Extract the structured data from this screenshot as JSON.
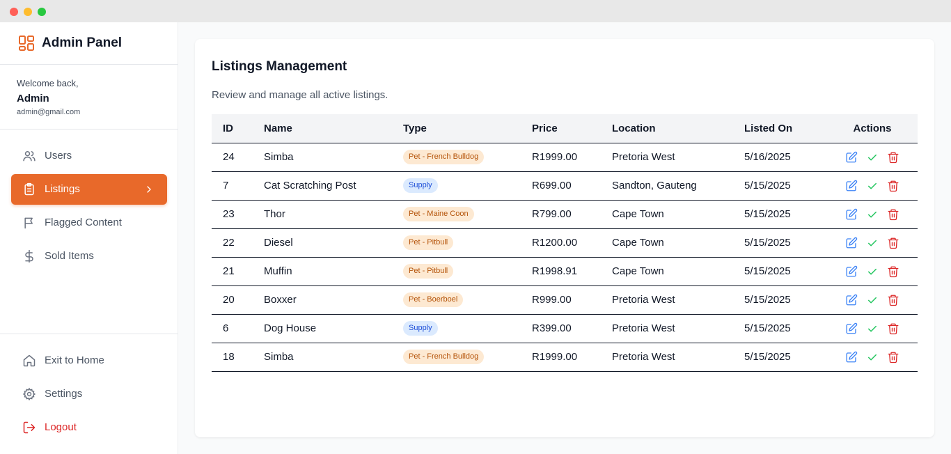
{
  "sidebar": {
    "brand": "Admin Panel",
    "welcome_label": "Welcome back,",
    "user_name": "Admin",
    "user_email": "admin@gmail.com",
    "nav": [
      {
        "label": "Users",
        "icon": "users-icon"
      },
      {
        "label": "Listings",
        "icon": "clipboard-icon",
        "active": true
      },
      {
        "label": "Flagged Content",
        "icon": "flag-icon"
      },
      {
        "label": "Sold Items",
        "icon": "dollar-icon"
      }
    ],
    "footer": [
      {
        "label": "Exit to Home",
        "icon": "home-icon"
      },
      {
        "label": "Settings",
        "icon": "gear-icon"
      },
      {
        "label": "Logout",
        "icon": "logout-icon"
      }
    ]
  },
  "main": {
    "title": "Listings Management",
    "subtitle": "Review and manage all active listings.",
    "columns": [
      "ID",
      "Name",
      "Type",
      "Price",
      "Location",
      "Listed On",
      "Actions"
    ],
    "rows": [
      {
        "id": "24",
        "name": "Simba",
        "type": "Pet - French Bulldog",
        "kind": "pet",
        "price": "R1999.00",
        "location": "Pretoria West",
        "listed": "5/16/2025"
      },
      {
        "id": "7",
        "name": "Cat Scratching Post",
        "type": "Supply",
        "kind": "supply",
        "price": "R699.00",
        "location": "Sandton, Gauteng",
        "listed": "5/15/2025"
      },
      {
        "id": "23",
        "name": "Thor",
        "type": "Pet - Maine Coon",
        "kind": "pet",
        "price": "R799.00",
        "location": "Cape Town",
        "listed": "5/15/2025"
      },
      {
        "id": "22",
        "name": "Diesel",
        "type": "Pet - Pitbull",
        "kind": "pet",
        "price": "R1200.00",
        "location": "Cape Town",
        "listed": "5/15/2025"
      },
      {
        "id": "21",
        "name": "Muffin",
        "type": "Pet - Pitbull",
        "kind": "pet",
        "price": "R1998.91",
        "location": "Cape Town",
        "listed": "5/15/2025"
      },
      {
        "id": "20",
        "name": "Boxxer",
        "type": "Pet - Boerboel",
        "kind": "pet",
        "price": "R999.00",
        "location": "Pretoria West",
        "listed": "5/15/2025"
      },
      {
        "id": "6",
        "name": "Dog House",
        "type": "Supply",
        "kind": "supply",
        "price": "R399.00",
        "location": "Pretoria West",
        "listed": "5/15/2025"
      },
      {
        "id": "18",
        "name": "Simba",
        "type": "Pet - French Bulldog",
        "kind": "pet",
        "price": "R1999.00",
        "location": "Pretoria West",
        "listed": "5/15/2025"
      }
    ]
  },
  "colors": {
    "accent": "#e8692a",
    "edit": "#3b82f6",
    "approve": "#22c55e",
    "delete": "#dc2626"
  }
}
